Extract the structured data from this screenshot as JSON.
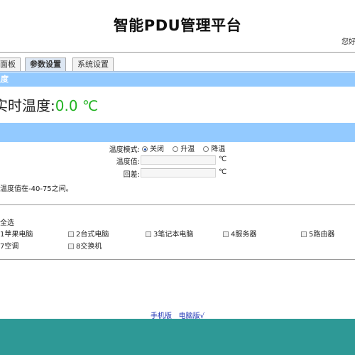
{
  "header": {
    "title": "智能PDU管理平台",
    "greeting": "您好"
  },
  "tabs": [
    {
      "label": "主面板",
      "active": false
    },
    {
      "label": "参数设置",
      "active": true
    },
    {
      "label": "系统设置",
      "active": false
    }
  ],
  "temperature_section": {
    "bar_label": "温度",
    "realtime_label": "实时温度:",
    "realtime_value": "0.0 ℃"
  },
  "control_section": {
    "bar_label": "",
    "mode_label": "温度模式:",
    "modes": [
      {
        "label": "关闭",
        "checked": true
      },
      {
        "label": "升温",
        "checked": false
      },
      {
        "label": "降温",
        "checked": false
      }
    ],
    "temp_value_label": "温度值:",
    "temp_value": "",
    "diff_label": "回差:",
    "diff_value": "",
    "unit": "℃",
    "note": "温度值在-40-75之间。"
  },
  "devices": {
    "select_all_label": "全选",
    "items": [
      {
        "label": "1苹果电脑",
        "checked": false
      },
      {
        "label": "2台式电脑",
        "checked": false
      },
      {
        "label": "3笔记本电脑",
        "checked": false
      },
      {
        "label": "4服务器",
        "checked": false
      },
      {
        "label": "5路由器",
        "checked": false
      },
      {
        "label": "7空调",
        "checked": false
      },
      {
        "label": "8交换机",
        "checked": false
      }
    ]
  },
  "footer_links": {
    "mobile": "手机版",
    "desktop": "电脑版√"
  },
  "colors": {
    "section_bar": "#93caff",
    "temp_value": "#22b322",
    "footer": "#2e9996",
    "link": "#1f35b5"
  }
}
